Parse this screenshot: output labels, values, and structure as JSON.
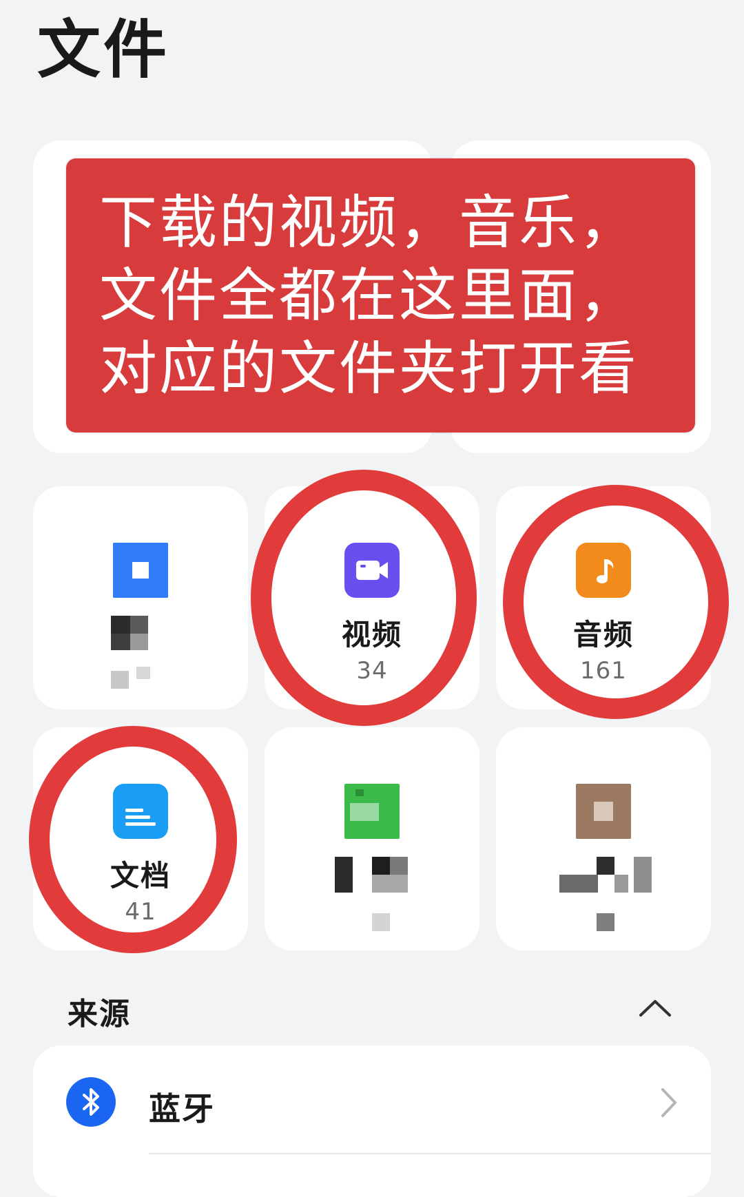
{
  "page_title": "文件",
  "banner": {
    "lines": [
      "下载的视频，音乐，",
      "文件全都在这里面，",
      "对应的文件夹打开看"
    ],
    "color": "#d83b3b"
  },
  "categories": [
    {
      "id": "blurred-1",
      "label": "",
      "count": "",
      "icon": "blurred-icon",
      "color": "#2f7cf6"
    },
    {
      "id": "video",
      "label": "视频",
      "count": "34",
      "icon": "video-camera-icon",
      "color": "#6a4ff0"
    },
    {
      "id": "audio",
      "label": "音频",
      "count": "161",
      "icon": "music-note-icon",
      "color": "#f28a1c"
    },
    {
      "id": "docs",
      "label": "文档",
      "count": "41",
      "icon": "document-icon",
      "color": "#1a9df5"
    },
    {
      "id": "blurred-2",
      "label": "",
      "count": "",
      "icon": "blurred-icon",
      "color": "#3dbb4a"
    },
    {
      "id": "blurred-3",
      "label": "",
      "count": "",
      "icon": "blurred-icon",
      "color": "#9c7a62"
    }
  ],
  "sources": {
    "title": "来源",
    "items": [
      {
        "label": "蓝牙",
        "icon": "bluetooth-icon",
        "color": "#1a66f0"
      }
    ]
  },
  "annotation_color": "#e23b3b"
}
